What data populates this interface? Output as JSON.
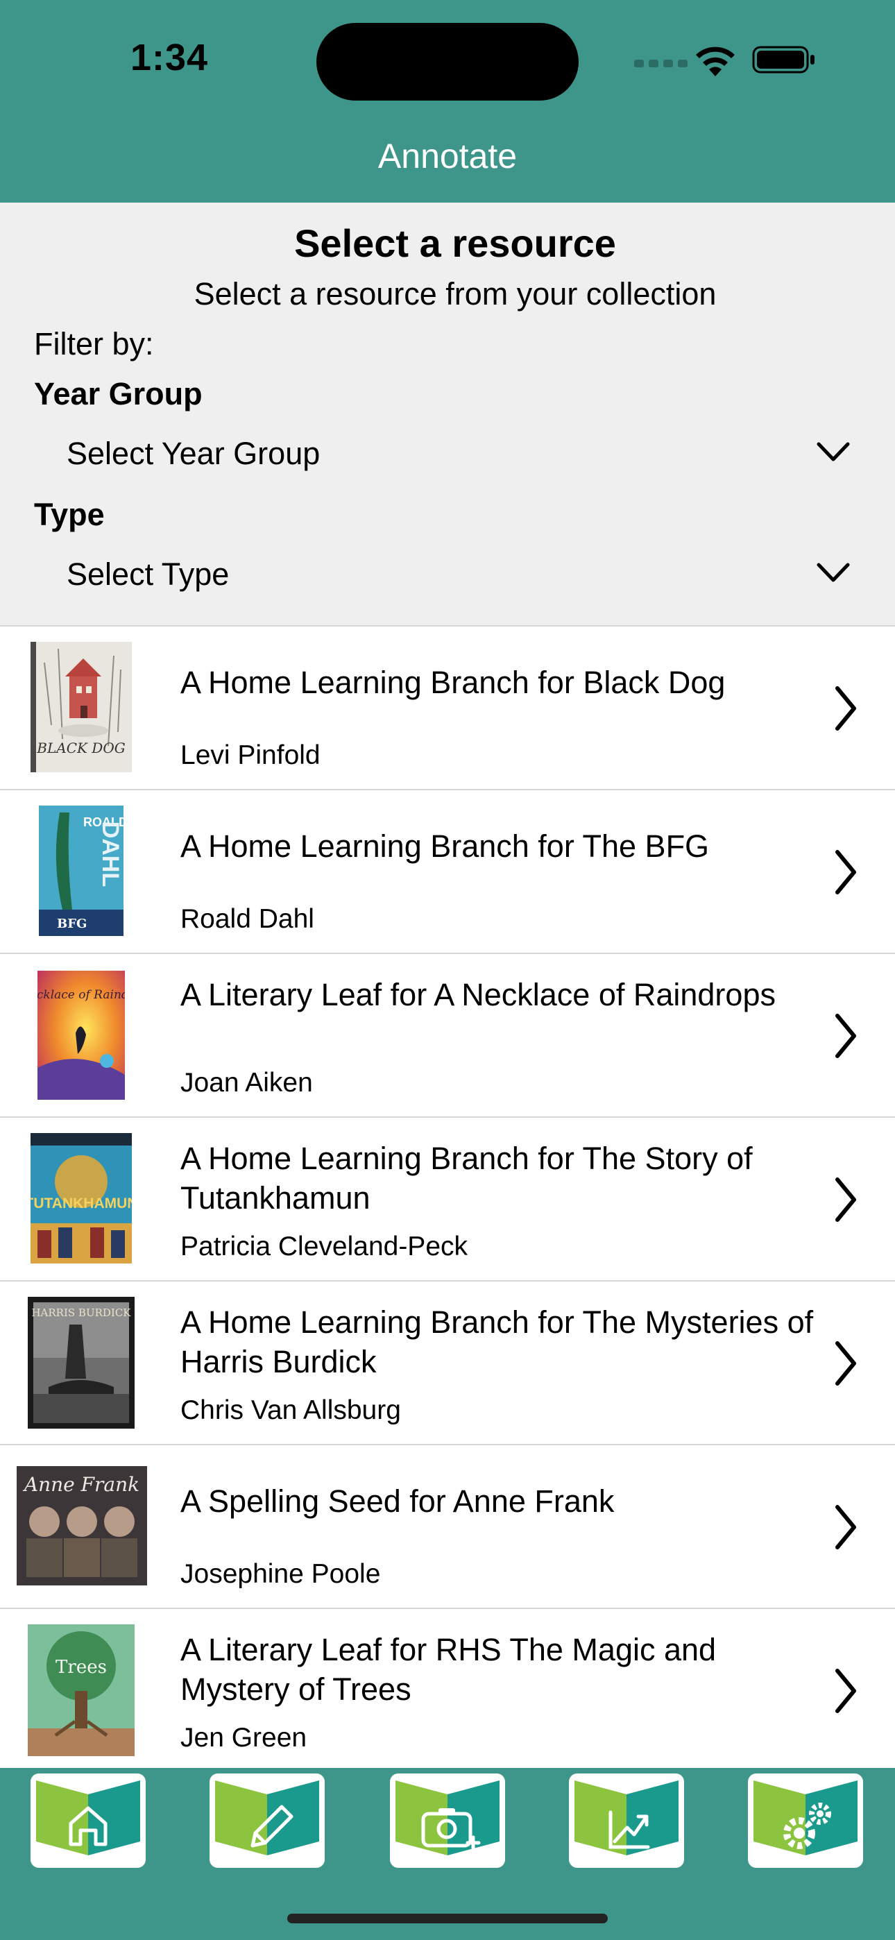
{
  "status_bar": {
    "time": "1:34"
  },
  "header": {
    "title": "Annotate"
  },
  "filter": {
    "heading": "Select a resource",
    "subheading": "Select a resource from your collection",
    "filter_label": "Filter by:",
    "year_group_label": "Year Group",
    "year_group_value": "Select Year Group",
    "type_label": "Type",
    "type_value": "Select Type"
  },
  "resources": [
    {
      "title": "A Home Learning Branch for Black Dog",
      "author": "Levi Pinfold",
      "cover_text": "BLACK DOG"
    },
    {
      "title": "A Home Learning Branch for The BFG",
      "author": "Roald Dahl",
      "cover_text": "DAHL"
    },
    {
      "title": "A Literary Leaf for A Necklace of Raindrops",
      "author": "Joan Aiken",
      "cover_text": "A Necklace of Raindrops"
    },
    {
      "title": "A Home Learning Branch for The Story of Tutankhamun",
      "author": "Patricia Cleveland-Peck",
      "cover_text": "TUTANKHAMUN"
    },
    {
      "title": "A Home Learning Branch for The Mysteries of Harris Burdick",
      "author": "Chris Van Allsburg",
      "cover_text": "HARRIS BURDICK"
    },
    {
      "title": "A Spelling Seed for Anne Frank",
      "author": "Josephine Poole",
      "cover_text": "Anne Frank"
    },
    {
      "title": "A Literary Leaf for RHS The Magic and Mystery of Trees",
      "author": "Jen Green",
      "cover_text": "Trees"
    }
  ],
  "tab_bar": {
    "tabs": [
      {
        "icon": "home-icon"
      },
      {
        "icon": "pencil-icon"
      },
      {
        "icon": "camera-add-icon"
      },
      {
        "icon": "chart-icon"
      },
      {
        "icon": "gear-icon"
      }
    ]
  },
  "colors": {
    "accent": "#3e968a",
    "book_green": "#8cc43f",
    "book_teal": "#1a9a8c"
  }
}
